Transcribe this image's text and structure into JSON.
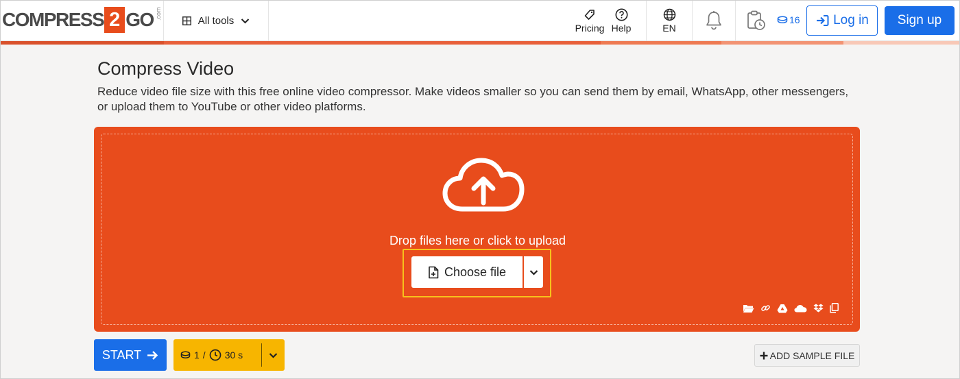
{
  "header": {
    "logo": {
      "part1": "COMPRESS",
      "part2": "2",
      "part3": "GO",
      "suffix": ".com"
    },
    "all_tools_label": "All tools",
    "pricing_label": "Pricing",
    "help_label": "Help",
    "language_label": "EN",
    "credits_count": "16",
    "login_label": "Log in",
    "signup_label": "Sign up"
  },
  "main": {
    "title": "Compress Video",
    "description": "Reduce video file size with this free online video compressor. Make videos smaller so you can send them by email, WhatsApp, other messengers, or upload them to YouTube or other video platforms.",
    "drop_text": "Drop files here or click to upload",
    "choose_file_label": "Choose file",
    "source_icons": [
      "folder-icon",
      "link-icon",
      "google-drive-icon",
      "onedrive-icon",
      "dropbox-icon",
      "clipboard-icon"
    ]
  },
  "actions": {
    "start_label": "START",
    "cost_credits": "1",
    "cost_separator": "/",
    "cost_time": "30 s",
    "add_sample_label": "ADD SAMPLE FILE"
  },
  "colors": {
    "brand_orange": "#e84c1c",
    "primary_blue": "#1a6ee8",
    "amber": "#f7b500",
    "highlight_yellow": "#f7c21b"
  }
}
